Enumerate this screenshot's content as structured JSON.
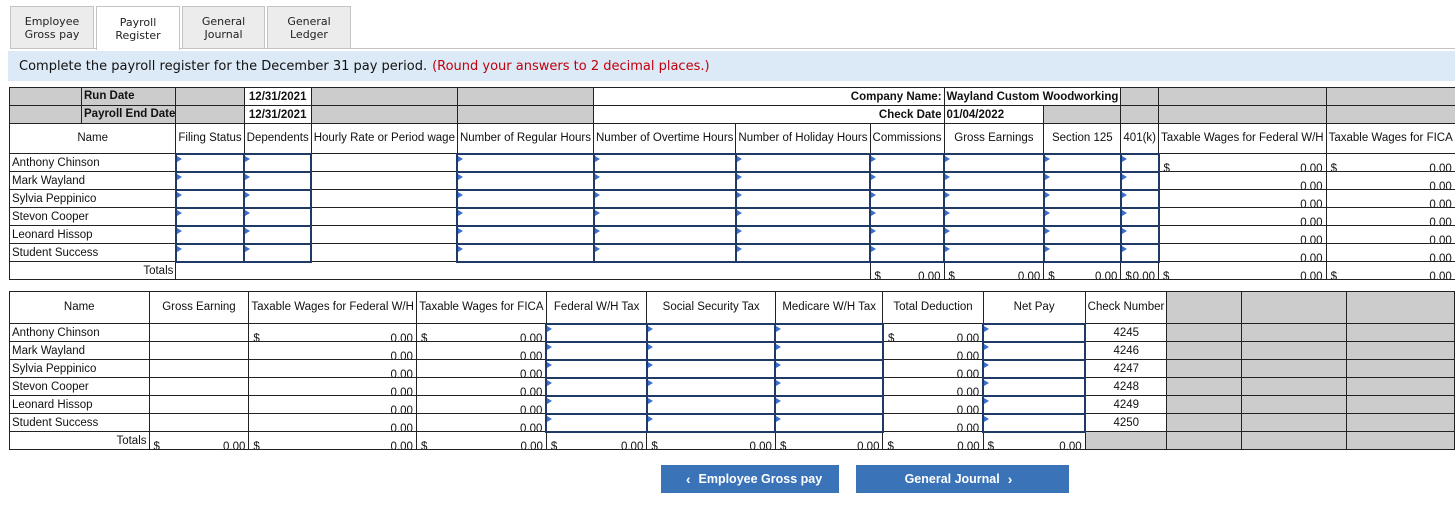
{
  "tabs": [
    {
      "label": "Employee\nGross pay"
    },
    {
      "label": "Payroll\nRegister"
    },
    {
      "label": "General\nJournal"
    },
    {
      "label": "General\nLedger"
    }
  ],
  "instruction": {
    "text": "Complete the payroll register for the December 31 pay period.",
    "note": "(Round your answers to 2 decimal places.)"
  },
  "header": {
    "run_date_label": "Run Date",
    "run_date": "12/31/2021",
    "payroll_end_date_label": "Payroll End Date",
    "payroll_end_date": "12/31/2021",
    "company_name_label": "Company Name:",
    "company_name": "Wayland Custom Woodworking",
    "check_date_label": "Check Date",
    "check_date": "01/04/2022"
  },
  "top": {
    "columns": [
      "Name",
      "Filing Status",
      "Dependents",
      "Hourly Rate or Period wage",
      "Number of Regular Hours",
      "Number of Overtime Hours",
      "Number of Holiday Hours",
      "Commissions",
      "Gross Earnings",
      "Section 125",
      "401(k)",
      "Taxable Wages for Federal W/H",
      "Taxable Wages for FICA"
    ],
    "rows": [
      {
        "name": "Anthony Chinson",
        "fed": "0.00",
        "fica": "0.00"
      },
      {
        "name": "Mark Wayland",
        "fed": "0.00",
        "fica": "0.00"
      },
      {
        "name": "Sylvia Peppinico",
        "fed": "0.00",
        "fica": "0.00"
      },
      {
        "name": "Stevon Cooper",
        "fed": "0.00",
        "fica": "0.00"
      },
      {
        "name": "Leonard Hissop",
        "fed": "0.00",
        "fica": "0.00"
      },
      {
        "name": "Student Success",
        "fed": "0.00",
        "fica": "0.00"
      }
    ],
    "totals_label": "Totals",
    "totals": {
      "commissions": "0.00",
      "gross": "0.00",
      "section125": "0.00",
      "k401": "0.00",
      "fed": "0.00",
      "fica": "0.00"
    }
  },
  "bottom": {
    "columns": [
      "Name",
      "Gross Earning",
      "Taxable Wages for Federal W/H",
      "Taxable Wages for FICA",
      "Federal W/H Tax",
      "Social Security Tax",
      "Medicare W/H Tax",
      "Total Deduction",
      "Net Pay",
      "Check Number"
    ],
    "rows": [
      {
        "name": "Anthony Chinson",
        "fed": "0.00",
        "fica": "0.00",
        "ded": "0.00",
        "check": "4245"
      },
      {
        "name": "Mark Wayland",
        "fed": "0.00",
        "fica": "0.00",
        "ded": "0.00",
        "check": "4246"
      },
      {
        "name": "Sylvia Peppinico",
        "fed": "0.00",
        "fica": "0.00",
        "ded": "0.00",
        "check": "4247"
      },
      {
        "name": "Stevon Cooper",
        "fed": "0.00",
        "fica": "0.00",
        "ded": "0.00",
        "check": "4248"
      },
      {
        "name": "Leonard Hissop",
        "fed": "0.00",
        "fica": "0.00",
        "ded": "0.00",
        "check": "4249"
      },
      {
        "name": "Student Success",
        "fed": "0.00",
        "fica": "0.00",
        "ded": "0.00",
        "check": "4250"
      }
    ],
    "totals_label": "Totals",
    "totals": {
      "gross": "0.00",
      "fed": "0.00",
      "fica": "0.00",
      "fwh": "0.00",
      "ss": "0.00",
      "med": "0.00",
      "ded": "0.00",
      "net": "0.00"
    }
  },
  "currency_symbol": "$",
  "nav": {
    "prev_label": "Employee Gross pay",
    "next_label": "General Journal"
  }
}
